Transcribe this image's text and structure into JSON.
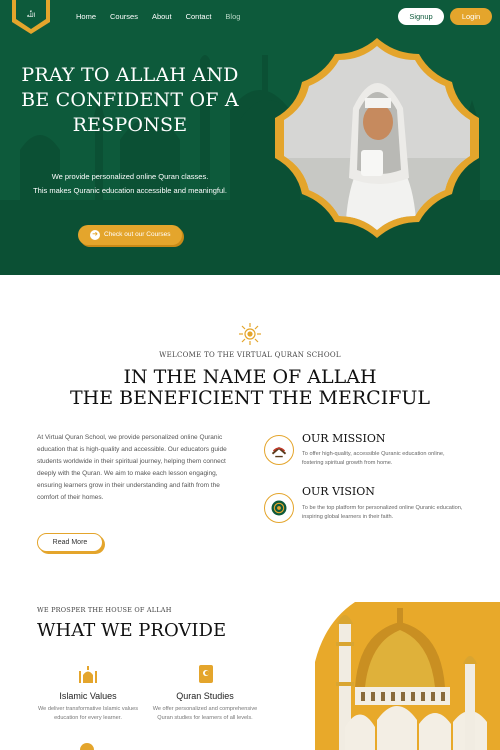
{
  "nav": {
    "links": [
      "Home",
      "Courses",
      "About",
      "Contact",
      "Blog"
    ],
    "signup": "Signup",
    "login": "Login",
    "logo_text": "اللّٰه"
  },
  "hero": {
    "title": "PRAY TO ALLAH AND BE CONFIDENT OF A RESPONSE",
    "subtitle_line1": "We provide personalized online Quran classes.",
    "subtitle_line2": "This makes Quranic education accessible and meaningful.",
    "cta": "Check out our Courses"
  },
  "welcome": {
    "kicker": "WELCOME TO THE VIRTUAL QURAN SCHOOL",
    "title_line1": "IN THE NAME OF ALLAH",
    "title_line2": "THE BENEFICIENT THE MERCIFUL",
    "intro": "At Virtual Quran School, we provide personalized online Quranic education that is high-quality and accessible. Our educators guide students worldwide in their spiritual journey, helping them connect deeply with the Quran. We aim to make each lesson engaging, ensuring learners grow in their understanding and faith from the comfort of their homes.",
    "read_more": "Read More"
  },
  "mission": {
    "title": "OUR MISSION",
    "text": "To offer high-quality, accessible Quranic education online, fostering spiritual growth from home."
  },
  "vision": {
    "title": "OUR VISION",
    "text": "To be the top platform for personalized online Quranic education, inspiring global learners in their faith."
  },
  "provide": {
    "kicker": "WE PROSPER THE HOUSE OF ALLAH",
    "title": "WHAT WE PROVIDE",
    "services": [
      {
        "title": "Islamic Values",
        "text": "We deliver transformative Islamic values education for every learner."
      },
      {
        "title": "Quran Studies",
        "text": "We offer personalized and comprehensive Quran studies for learners of all levels."
      }
    ]
  },
  "colors": {
    "primary_green": "#0d5a3b",
    "accent_gold": "#e4a52c"
  }
}
